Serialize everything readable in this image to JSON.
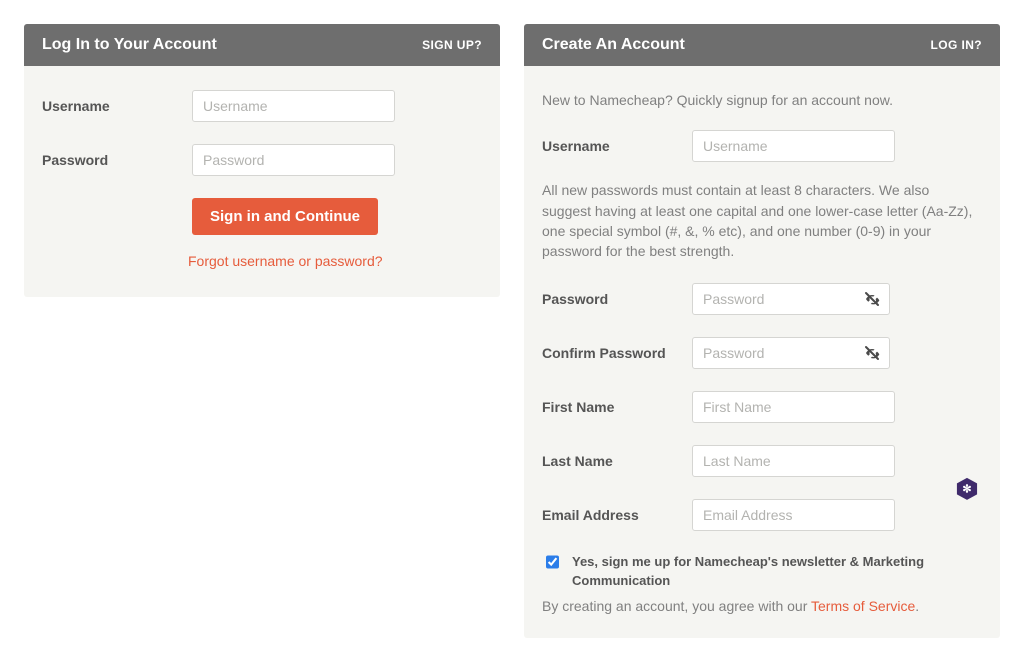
{
  "login": {
    "title": "Log In to Your Account",
    "signup_link": "SIGN UP?",
    "username_label": "Username",
    "username_placeholder": "Username",
    "password_label": "Password",
    "password_placeholder": "Password",
    "submit_label": "Sign in and Continue",
    "forgot_label": "Forgot username or password?"
  },
  "signup": {
    "title": "Create An Account",
    "login_link": "LOG IN?",
    "intro": "New to Namecheap? Quickly signup for an account now.",
    "username_label": "Username",
    "username_placeholder": "Username",
    "password_help": "All new passwords must contain at least 8 characters. We also suggest having at least one capital and one lower-case letter (Aa-Zz), one special symbol (#, &, % etc), and one number (0-9) in your password for the best strength.",
    "password_label": "Password",
    "password_placeholder": "Password",
    "confirm_label": "Confirm Password",
    "confirm_placeholder": "Password",
    "firstname_label": "First Name",
    "firstname_placeholder": "First Name",
    "lastname_label": "Last Name",
    "lastname_placeholder": "Last Name",
    "email_label": "Email Address",
    "email_placeholder": "Email Address",
    "newsletter_label": "Yes, sign me up for Namecheap's newsletter & Marketing Communication",
    "tos_prefix": "By creating an account, you agree with our ",
    "tos_link": "Terms of Service",
    "tos_suffix": "."
  }
}
